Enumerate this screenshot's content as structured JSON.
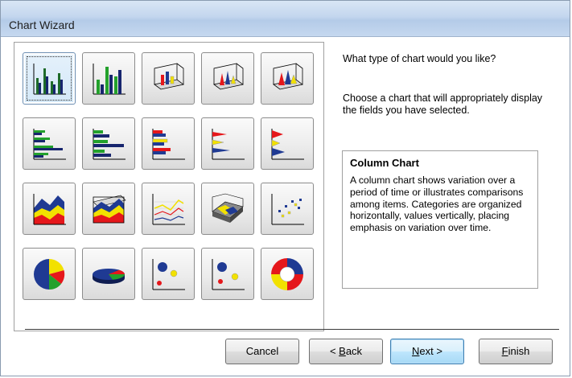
{
  "window": {
    "title": "Chart Wizard"
  },
  "gallery": {
    "selected": "column-chart",
    "tiles": [
      {
        "icon": "column-chart-icon"
      },
      {
        "icon": "stacked-column-chart-icon"
      },
      {
        "icon": "3d-column-chart-icon"
      },
      {
        "icon": "3d-cone-chart-icon"
      },
      {
        "icon": "3d-pyramid-chart-icon"
      },
      {
        "icon": "bar-chart-icon"
      },
      {
        "icon": "stacked-bar-chart-icon"
      },
      {
        "icon": "stacked-bar-chart-2-icon"
      },
      {
        "icon": "cone-bar-chart-icon"
      },
      {
        "icon": "pyramid-bar-chart-icon"
      },
      {
        "icon": "area-chart-icon"
      },
      {
        "icon": "3d-area-chart-icon"
      },
      {
        "icon": "line-chart-icon"
      },
      {
        "icon": "3d-surface-chart-icon"
      },
      {
        "icon": "xy-scatter-chart-icon"
      },
      {
        "icon": "pie-chart-icon"
      },
      {
        "icon": "3d-pie-chart-icon"
      },
      {
        "icon": "bubble-chart-icon"
      },
      {
        "icon": "bubble-chart-2-icon"
      },
      {
        "icon": "doughnut-chart-icon"
      }
    ]
  },
  "prompt": {
    "question": "What type of chart would you like?",
    "instruction": "Choose a chart that will appropriately display the fields you have selected."
  },
  "description": {
    "title": "Column Chart",
    "text": "A column chart shows variation over a period of time or illustrates comparisons among items. Categories are organized horizontally, values vertically, placing emphasis on variation over time."
  },
  "buttons": {
    "cancel": "Cancel",
    "back_prefix": "< ",
    "back_accel": "B",
    "back_rest": "ack",
    "next_accel": "N",
    "next_rest": "ext >",
    "finish_accel": "F",
    "finish_rest": "inish"
  },
  "colors": {
    "red": "#e5171b",
    "yellow": "#f2e100",
    "blue": "#1f3a93",
    "green": "#23a12c",
    "navy": "#17256e"
  }
}
